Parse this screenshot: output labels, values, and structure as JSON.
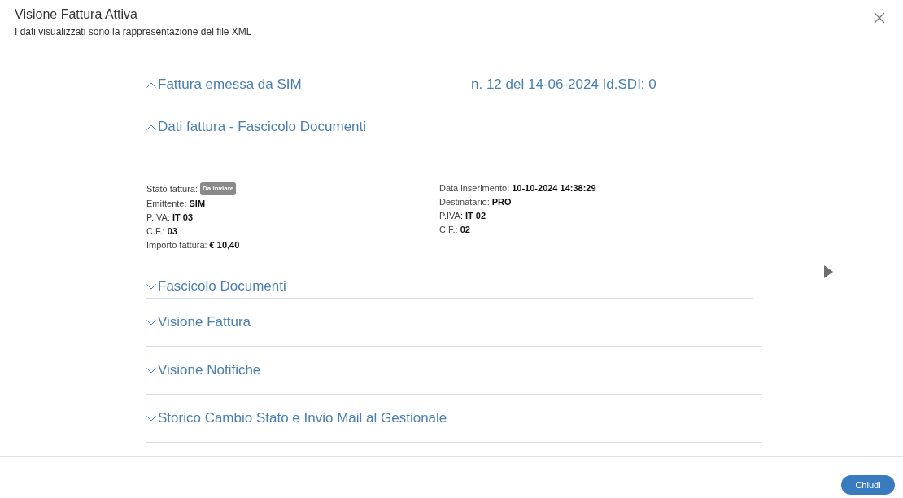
{
  "dialog": {
    "title": "Visione Fattura Attiva",
    "subtitle": "I dati visualizzati sono la rappresentazione del file XML"
  },
  "sections": [
    {
      "title": "Fattura emessa da SIM",
      "info": "n. 12 del 14-06-2024 Id.SDI: 0",
      "expanded": true
    },
    {
      "title": "Dati fattura - Fascicolo Documenti",
      "expanded": true,
      "details": {
        "left": [
          {
            "label": "Stato fattura:",
            "badge": "Da inviare"
          },
          {
            "label": "Emittente:",
            "value": "SIM"
          },
          {
            "label": "P.IVA:",
            "value": "IT 03"
          },
          {
            "label": "C.F.:",
            "value": "03"
          },
          {
            "label": "Importo fattura:",
            "value": "€ 10,40"
          }
        ],
        "right": [
          {
            "label": "Data inserimento:",
            "value": "10-10-2024 14:38:29"
          },
          {
            "label": "Destinatario:",
            "value": "PRO"
          },
          {
            "label": "P.IVA:",
            "value": "IT 02"
          },
          {
            "label": "C.F.:",
            "value": "02"
          }
        ]
      },
      "children": [
        {
          "title": "Fascicolo Documenti",
          "expanded": false
        }
      ]
    },
    {
      "title": "Visione Fattura",
      "expanded": false
    },
    {
      "title": "Visione Notifiche",
      "expanded": false
    },
    {
      "title": "Storico Cambio Stato e Invio Mail al Gestionale",
      "expanded": false
    }
  ],
  "buttons": [
    "Chiudi"
  ]
}
